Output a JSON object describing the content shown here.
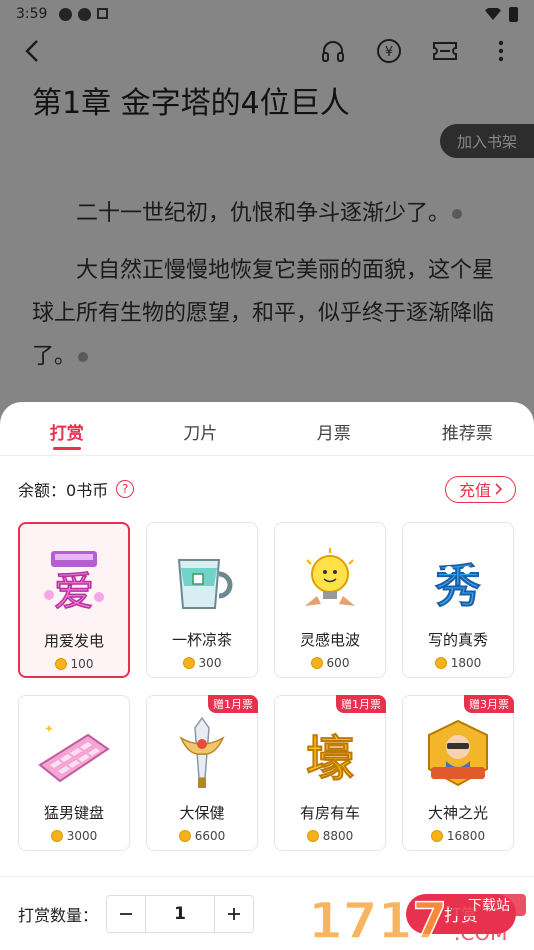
{
  "status_bar": {
    "time": "3:59"
  },
  "toolbar": {
    "icons": [
      "back-icon",
      "headphones-icon",
      "yuan-coin-icon",
      "ticket-icon",
      "more-vertical-icon"
    ]
  },
  "chapter": {
    "title": "第1章 金字塔的4位巨人",
    "add_to_shelf": "加入书架",
    "paragraphs": [
      "二十一世纪初，仇恨和争斗逐渐少了。",
      "大自然正慢慢地恢复它美丽的面貌，这个星球上所有生物的愿望，和平，似乎终于逐渐降临了。"
    ]
  },
  "sheet": {
    "tabs": [
      "打赏",
      "刀片",
      "月票",
      "推荐票"
    ],
    "active_tab": "打赏",
    "balance_label": "余额：",
    "balance_value": "0书币",
    "recharge_label": "充值",
    "gifts": [
      {
        "name": "用爱发电",
        "price": "100",
        "badge": "",
        "icon": "love-power-icon"
      },
      {
        "name": "一杯凉茶",
        "price": "300",
        "badge": "",
        "icon": "tea-cup-icon"
      },
      {
        "name": "灵感电波",
        "price": "600",
        "badge": "",
        "icon": "lightbulb-icon"
      },
      {
        "name": "写的真秀",
        "price": "1800",
        "badge": "",
        "icon": "xiu-character-icon"
      },
      {
        "name": "猛男键盘",
        "price": "3000",
        "badge": "",
        "icon": "keyboard-icon"
      },
      {
        "name": "大保健",
        "price": "6600",
        "badge": "赠1月票",
        "icon": "sword-icon"
      },
      {
        "name": "有房有车",
        "price": "8800",
        "badge": "赠1月票",
        "icon": "house-character-icon"
      },
      {
        "name": "大神之光",
        "price": "16800",
        "badge": "赠3月票",
        "icon": "master-badge-icon"
      }
    ],
    "quantity_label": "打赏数量：",
    "quantity": "1",
    "reward_label": "打赏"
  },
  "colors": {
    "accent": "#e8314c",
    "coin": "#f5b21b"
  },
  "watermark": {
    "number": "1717",
    "site": "下载站",
    "suffix": ".COM"
  }
}
